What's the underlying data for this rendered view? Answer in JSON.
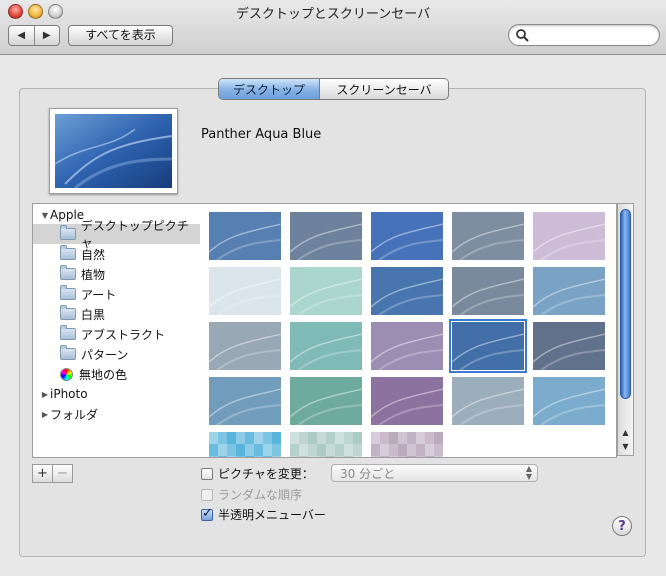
{
  "window": {
    "title": "デスクトップとスクリーンセーバ"
  },
  "toolbar": {
    "back_label": "◀",
    "forward_label": "▶",
    "show_all_label": "すべてを表示",
    "search_value": "",
    "search_placeholder": ""
  },
  "tabs": [
    {
      "label": "デスクトップ",
      "active": true
    },
    {
      "label": "スクリーンセーバ",
      "active": false
    }
  ],
  "current_picture": {
    "name": "Panther Aqua Blue"
  },
  "sources": [
    {
      "label": "Apple",
      "type": "group",
      "expanded": true
    },
    {
      "label": "デスクトップピクチャ",
      "type": "folder",
      "selected": true
    },
    {
      "label": "自然",
      "type": "folder"
    },
    {
      "label": "植物",
      "type": "folder"
    },
    {
      "label": "アート",
      "type": "folder"
    },
    {
      "label": "白黒",
      "type": "folder"
    },
    {
      "label": "アブストラクト",
      "type": "folder"
    },
    {
      "label": "パターン",
      "type": "folder"
    },
    {
      "label": "無地の色",
      "type": "color"
    },
    {
      "label": "iPhoto",
      "type": "group",
      "expanded": false
    },
    {
      "label": "フォルダ",
      "type": "group",
      "expanded": false
    }
  ],
  "source_buttons": {
    "add_label": "+",
    "remove_label": "−"
  },
  "thumbnails": {
    "selected_index": 13,
    "colors": [
      "#3f6ea8",
      "#5a7191",
      "#2d5fb0",
      "#6c7f95",
      "#c8b3d2",
      "#d6e3ea",
      "#9fd1c6",
      "#2f62a2",
      "#667a8f",
      "#6896bd",
      "#8b9dab",
      "#6fb1ad",
      "#8f7ea9",
      "#2a5c9e",
      "#4a5f7c",
      "#5f8fb3",
      "#5c9f92",
      "#7d5f92",
      "#8ea3b3",
      "#6aa1c6",
      "#4fb0d8",
      "#a8c8bf",
      "#b7a4bb"
    ]
  },
  "options": {
    "change_picture_label": "ピクチャを変更：",
    "change_picture_checked": false,
    "interval_value": "30 分ごと",
    "random_order_label": "ランダムな順序",
    "random_order_checked": false,
    "translucent_menubar_label": "半透明メニューバー",
    "translucent_menubar_checked": true,
    "help_label": "?"
  }
}
